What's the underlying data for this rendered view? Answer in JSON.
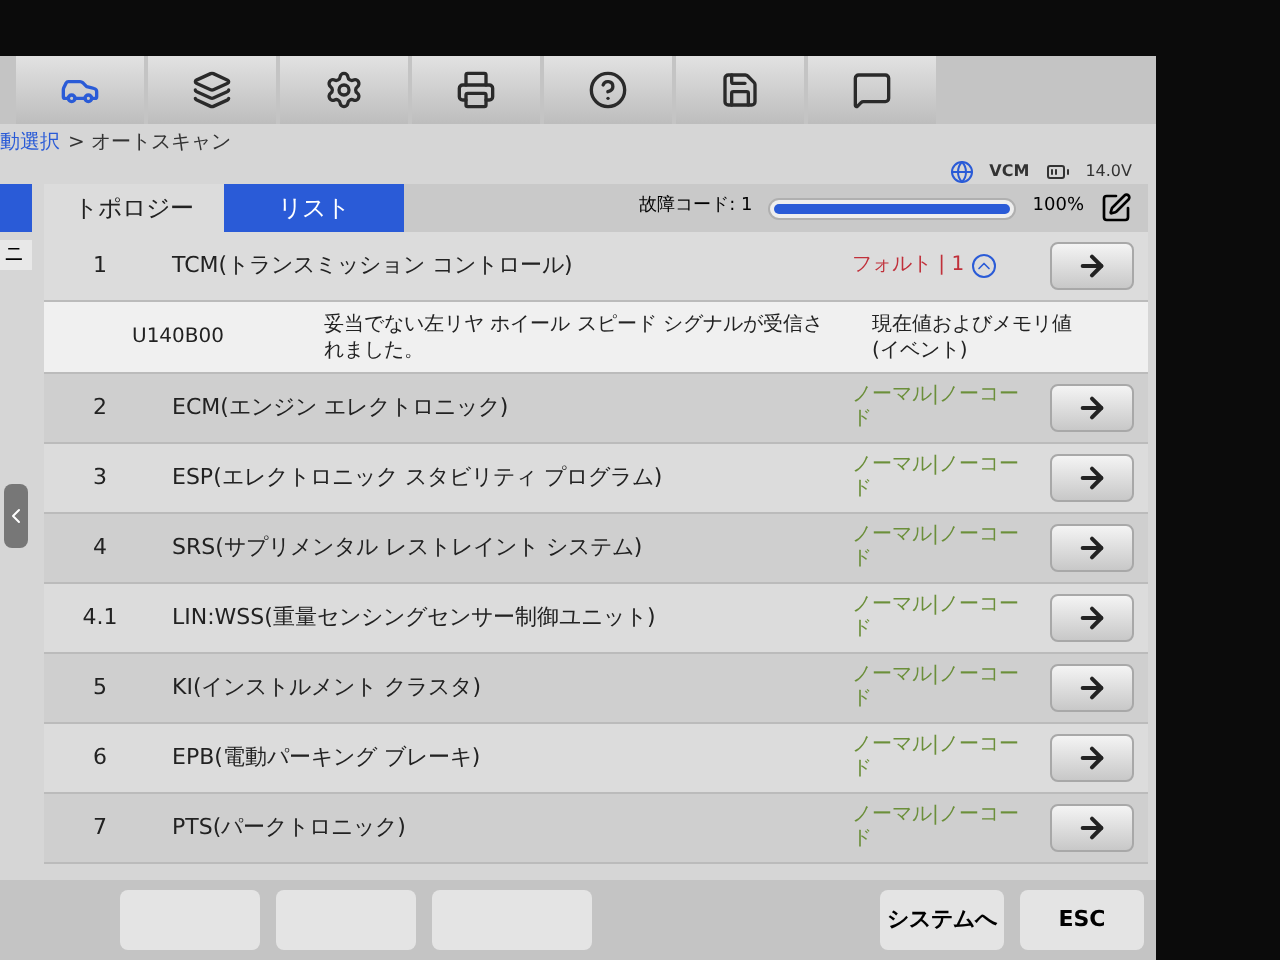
{
  "toolbar": [
    {
      "kind": "car",
      "selected": true
    },
    {
      "kind": "lift",
      "selected": false
    },
    {
      "kind": "gear",
      "selected": false
    },
    {
      "kind": "printer",
      "selected": false
    },
    {
      "kind": "help",
      "selected": false
    },
    {
      "kind": "save",
      "selected": false
    },
    {
      "kind": "chat",
      "selected": false
    }
  ],
  "breadcrumb": {
    "link": "動選択",
    "current": "> オートスキャン"
  },
  "status": {
    "vci": "VCM",
    "voltage": "14.0V"
  },
  "sidebar": {
    "label": "ニ"
  },
  "tabs": [
    {
      "label": "トポロジー",
      "selected": false
    },
    {
      "label": "リスト",
      "selected": true
    }
  ],
  "fault_summary": {
    "label": "故障コード: 1",
    "level": 1,
    "percent": "100%"
  },
  "rows": [
    {
      "number": "1",
      "name": "TCM(トランスミッション コントロール)",
      "kind": "fault",
      "status": "フォルト | 1",
      "expanded": true,
      "details": [
        {
          "code": "U140B00",
          "description": "妥当でない左リヤ ホイール スピード シグナルが受信されました。",
          "type": "現在値およびメモリ値(イベント)"
        }
      ]
    },
    {
      "number": "2",
      "name": "ECM(エンジン エレクトロニック)",
      "kind": "normal",
      "status": "ノーマル|ノーコード"
    },
    {
      "number": "3",
      "name": "ESP(エレクトロニック スタビリティ プログラム)",
      "kind": "normal",
      "status": "ノーマル|ノーコード"
    },
    {
      "number": "4",
      "name": "SRS(サプリメンタル レストレイント システム)",
      "kind": "normal",
      "status": "ノーマル|ノーコード"
    },
    {
      "number": "4.1",
      "name": "LIN:WSS(重量センシングセンサー制御ユニット)",
      "kind": "normal",
      "status": "ノーマル|ノーコード"
    },
    {
      "number": "5",
      "name": "KI(インストルメント クラスタ)",
      "kind": "normal",
      "status": "ノーマル|ノーコード"
    },
    {
      "number": "6",
      "name": "EPB(電動パーキング ブレーキ)",
      "kind": "normal",
      "status": "ノーマル|ノーコード"
    },
    {
      "number": "7",
      "name": "PTS(パークトロニック)",
      "kind": "normal",
      "status": "ノーマル|ノーコード"
    }
  ],
  "bottom_buttons": [
    {
      "label": "システムへ"
    },
    {
      "label": "ESC"
    }
  ]
}
